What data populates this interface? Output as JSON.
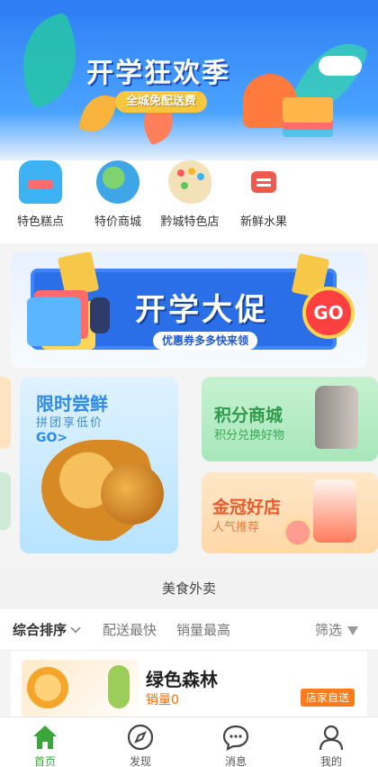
{
  "hero": {
    "title": "开学狂欢季",
    "pill": "全城免配送费"
  },
  "categories": [
    {
      "label": "特色糕点",
      "icon": "backpack-icon"
    },
    {
      "label": "特价商城",
      "icon": "globe-icon"
    },
    {
      "label": "黔城特色店",
      "icon": "palette-icon"
    },
    {
      "label": "新鲜水果",
      "icon": "fruit-icon"
    }
  ],
  "promo": {
    "title": "开学大促",
    "subtitle": "优惠券多多快来领",
    "go": "GO"
  },
  "features": {
    "left": {
      "title": "限时尝鲜",
      "subtitle": "拼团享低价",
      "cta": "GO>"
    },
    "right_top": {
      "title": "积分商城",
      "subtitle": "积分兑换好物"
    },
    "right_bottom": {
      "title": "金冠好店",
      "subtitle": "人气推荐"
    }
  },
  "section_title": "美食外卖",
  "sort": {
    "comprehensive": "综合排序",
    "fast": "配送最快",
    "sales": "销量最高",
    "filter": "筛选"
  },
  "store": {
    "name": "绿色森林",
    "sales": "销量0",
    "tag": "店家自送"
  },
  "tabs": [
    {
      "label": "首页",
      "icon": "home-icon",
      "active": true
    },
    {
      "label": "发现",
      "icon": "compass-icon",
      "active": false
    },
    {
      "label": "消息",
      "icon": "message-icon",
      "active": false
    },
    {
      "label": "我的",
      "icon": "user-icon",
      "active": false
    }
  ],
  "colors": {
    "accent_green": "#3aa53a",
    "orange": "#ff7a1a",
    "brand_blue": "#2f7ef4"
  }
}
